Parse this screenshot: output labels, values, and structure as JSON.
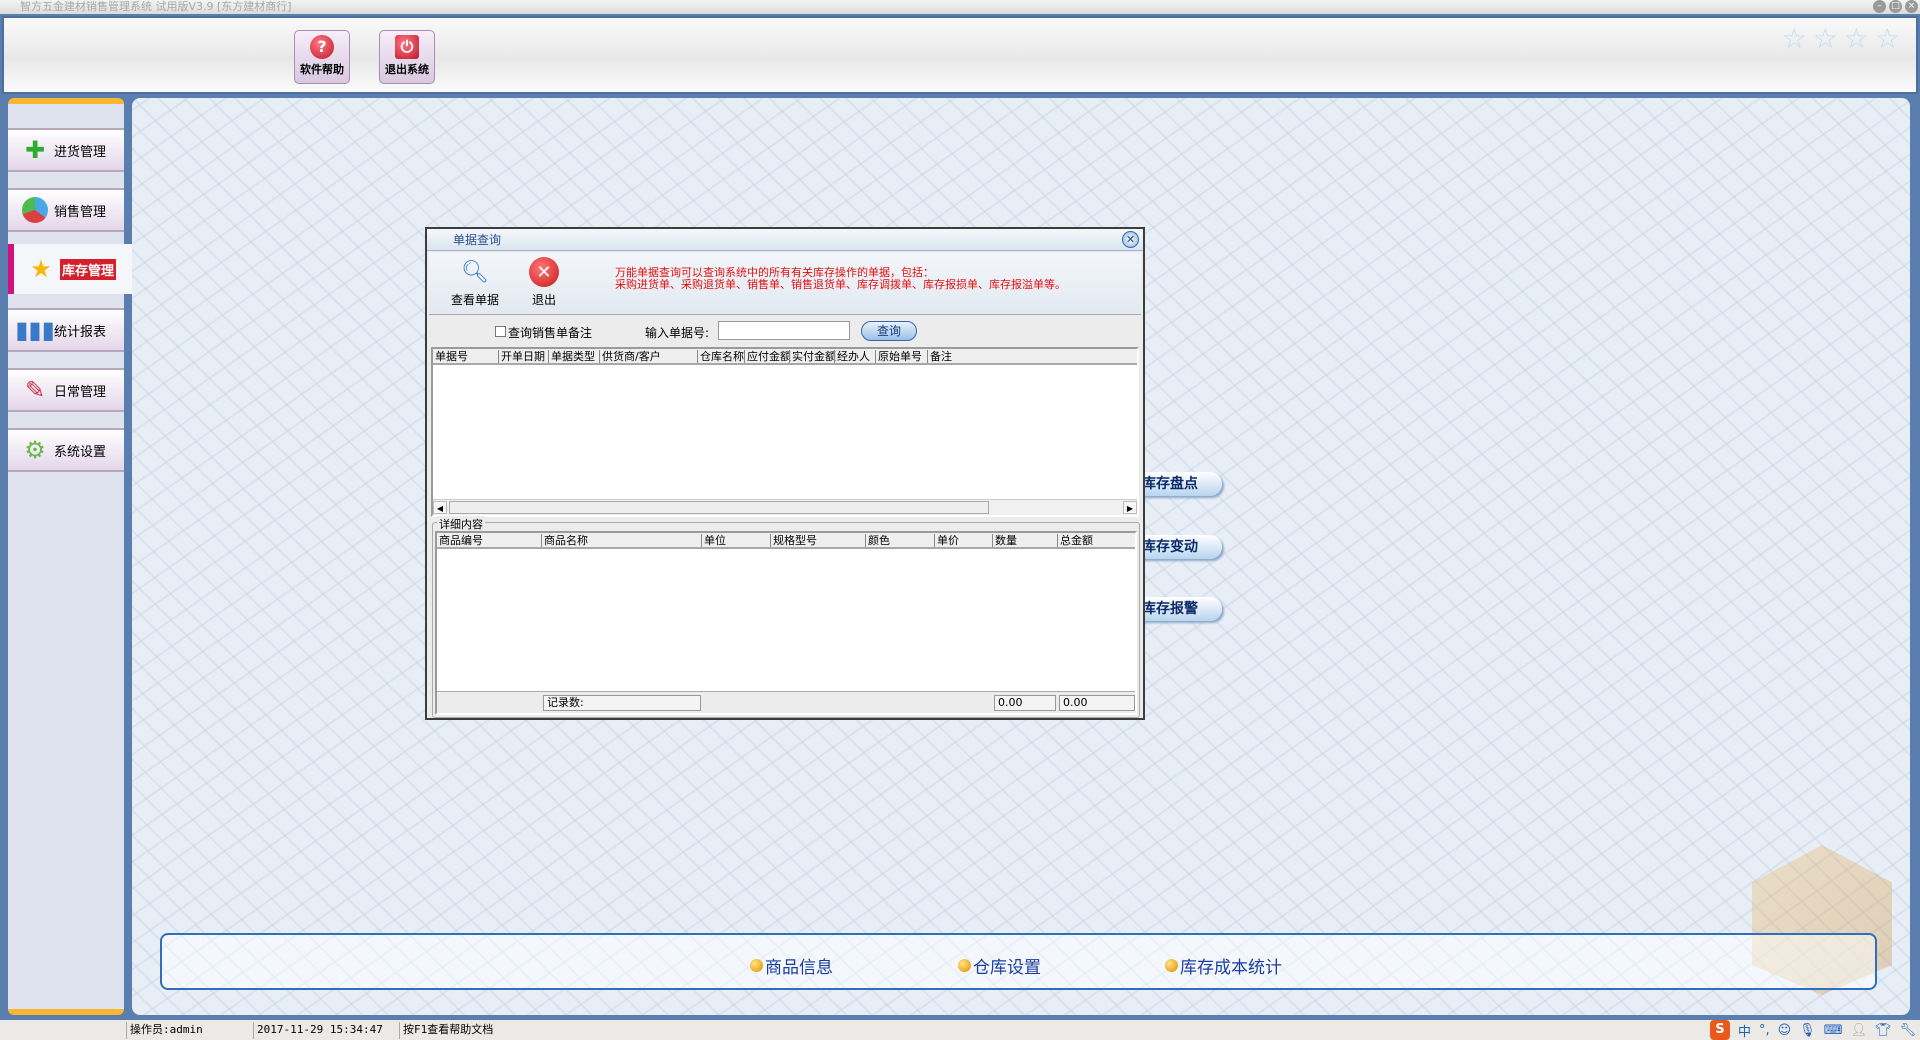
{
  "window": {
    "title": "智方五金建材销售管理系统 试用版V3.9 [东方建材商行]"
  },
  "toolbar": {
    "help_label": "软件帮助",
    "exit_label": "退出系统"
  },
  "sidebar": {
    "items": [
      {
        "label": "进货管理",
        "icon": "plus-icon"
      },
      {
        "label": "销售管理",
        "icon": "pie-icon"
      },
      {
        "label": "库存管理",
        "icon": "star-icon",
        "active": true
      },
      {
        "label": "统计报表",
        "icon": "bar-chart-icon"
      },
      {
        "label": "日常管理",
        "icon": "brush-icon"
      },
      {
        "label": "系统设置",
        "icon": "gear-icon"
      }
    ]
  },
  "main": {
    "side_buttons": [
      "库存盘点",
      "库存变动",
      "库存报警"
    ],
    "bottom_links": [
      "商品信息",
      "仓库设置",
      "库存成本统计"
    ]
  },
  "dialog": {
    "title": "单据查询",
    "view_label": "查看单据",
    "exit_label": "退出",
    "notice_line1": "万能单据查询可以查询系统中的所有有关库存操作的单据，包括：",
    "notice_line2": "采购进货单、采购退货单、销售单、销售退货单、库存调拨单、库存报损单、库存报溢单等。",
    "checkbox_label": "查询销售单备注",
    "input_label": "输入单据号:",
    "input_value": "",
    "query_label": "查询",
    "list_columns": [
      "单据号",
      "开单日期",
      "单据类型",
      "供货商/客户",
      "仓库名称",
      "应付金额",
      "实付金额",
      "经办人",
      "原始单号",
      "备注"
    ],
    "detail_title": "详细内容",
    "detail_columns": [
      "商品编号",
      "商品名称",
      "单位",
      "规格型号",
      "颜色",
      "单价",
      "数量",
      "总金额"
    ],
    "record_label": "记录数:",
    "qty_total": "0.00",
    "amount_total": "0.00"
  },
  "status": {
    "operator": "操作员:admin",
    "datetime": "2017-11-29 15:34:47",
    "hint": "按F1查看帮助文档"
  },
  "tray": {
    "ime": "S",
    "lang": "中",
    "punct": "°,"
  }
}
